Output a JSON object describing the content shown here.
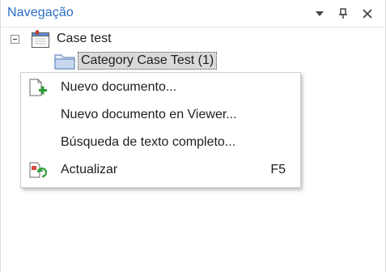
{
  "panel": {
    "title": "Navegação",
    "buttons": [
      "dropdown-icon",
      "pin-icon",
      "close-icon"
    ]
  },
  "tree": {
    "root": {
      "label": "Case test",
      "expanded": true,
      "icon": "case-icon"
    },
    "child": {
      "label": "Category Case Test (1)",
      "selected": true,
      "icon": "folder-icon"
    }
  },
  "context_menu": {
    "items": [
      {
        "label": "Nuevo documento...",
        "icon": "new-document-icon",
        "shortcut": ""
      },
      {
        "label": "Nuevo documento en Viewer...",
        "icon": "",
        "shortcut": ""
      },
      {
        "label": "Búsqueda de texto completo...",
        "icon": "",
        "shortcut": ""
      },
      {
        "label": "Actualizar",
        "icon": "refresh-icon",
        "shortcut": "F5"
      }
    ]
  },
  "colors": {
    "title": "#2b6cc4",
    "selection": "#d9d9d9",
    "add_green": "#2e9e3a"
  }
}
